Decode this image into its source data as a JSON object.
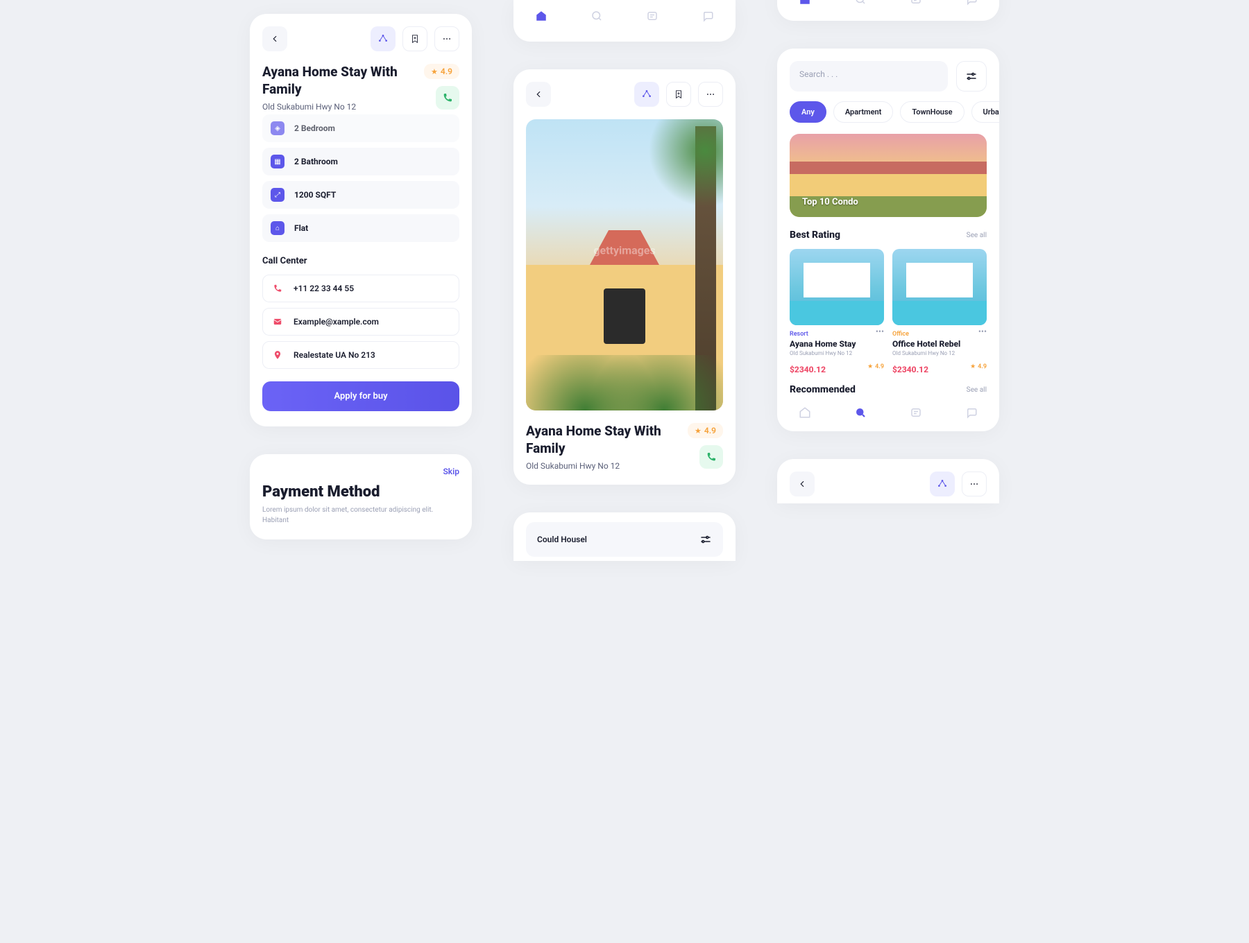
{
  "screen1": {
    "title": "Ayana Home Stay With Family",
    "address": "Old Sukabumi Hwy No 12",
    "rating": "4.9",
    "specs": {
      "bedroom": "2 Bedroom",
      "bathroom": "2 Bathroom",
      "sqft": "1200 SQFT",
      "type": "Flat"
    },
    "call_center_label": "Call Center",
    "contacts": {
      "phone": "+11 22 33 44 55",
      "email": "Example@xample.com",
      "address": "Realestate UA No 213"
    },
    "cta": "Apply for buy"
  },
  "screen2": {
    "skip": "Skip",
    "heading": "Payment Method",
    "desc": "Lorem ipsum dolor sit amet, consectetur adipiscing elit. Habitant"
  },
  "screen3": {
    "title": "Ayana Home Stay With Family",
    "address": "Old Sukabumi Hwy No 12",
    "rating": "4.9",
    "watermark": "gettyimages"
  },
  "screen4": {
    "could": "Could Housel"
  },
  "screen5": {
    "search_placeholder": "Search . . .",
    "chips": {
      "any": "Any",
      "apartment": "Apartment",
      "townhouse": "TownHouse",
      "urban": "Urban"
    },
    "banner": "Top 10 Condo",
    "best_rating": "Best Rating",
    "see_all": "See all",
    "recommended": "Recommended",
    "cards": [
      {
        "tag": "Resort",
        "name": "Ayana Home Stay",
        "loc": "Old Sukabumi Hwy No 12",
        "price": "$2340.12",
        "rating": "4.9"
      },
      {
        "tag": "Office",
        "name": "Office Hotel Rebel",
        "loc": "Old Sukabumi Hwy No 12",
        "price": "$2340.12",
        "rating": "4.9"
      }
    ]
  }
}
